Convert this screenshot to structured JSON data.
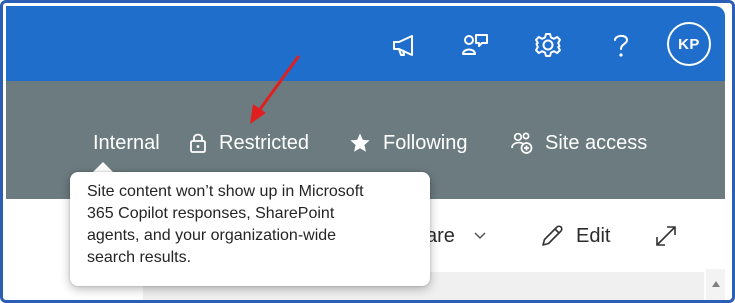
{
  "header": {
    "avatar_initials": "KP",
    "icons": [
      "megaphone-icon",
      "feedback-icon",
      "gear-icon",
      "help-icon"
    ]
  },
  "site_bar": {
    "internal_label": "Internal",
    "restricted_label": "Restricted",
    "following_label": "Following",
    "site_access_label": "Site access"
  },
  "command_bar": {
    "share_label": "are",
    "edit_label": "Edit"
  },
  "tooltip": {
    "lines": [
      "Site content won’t show up in Microsoft",
      "365 Copilot responses, SharePoint",
      "agents, and your organization-wide",
      "search results."
    ]
  },
  "colors": {
    "header_blue": "#1f6ecb",
    "site_bar_gray": "#6b7b80",
    "annotation_red": "#e02020",
    "frame_border": "#2a5fb5"
  }
}
